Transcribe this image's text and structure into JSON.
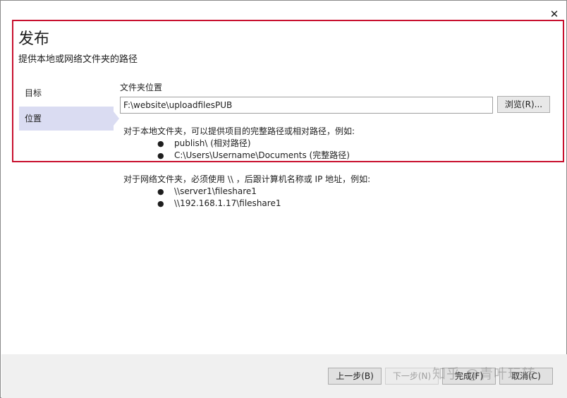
{
  "window": {
    "close_glyph": "✕"
  },
  "header": {
    "title": "发布",
    "subtitle": "提供本地或网络文件夹的路径"
  },
  "sidebar": {
    "items": [
      {
        "label": "目标"
      },
      {
        "label": "位置",
        "selected": true
      }
    ]
  },
  "main": {
    "field_label": "文件夹位置",
    "path_value": "F:\\website\\uploadfilesPUB",
    "browse_label": "浏览(R)...",
    "help_local": {
      "intro": "对于本地文件夹，可以提供项目的完整路径或相对路径，例如:",
      "examples": [
        "publish\\ (相对路径)",
        "C:\\Users\\Username\\Documents (完整路径)"
      ]
    },
    "help_network": {
      "intro": "对于网络文件夹，必须使用 \\\\ ，后跟计算机名称或 IP 地址，例如:",
      "examples": [
        "\\\\server1\\fileshare1",
        "\\\\192.168.1.17\\fileshare1"
      ]
    },
    "bullet": "●"
  },
  "footer": {
    "prev_label": "上一步(B)",
    "next_label": "下一步(N)",
    "finish_label": "完成(F)",
    "cancel_label": "取消(C)"
  },
  "watermark": "知乎 @青叶玩转",
  "colors": {
    "highlight": "#c8102e",
    "selected_nav": "#dadcf2",
    "footer_bg": "#f0f0f0"
  }
}
